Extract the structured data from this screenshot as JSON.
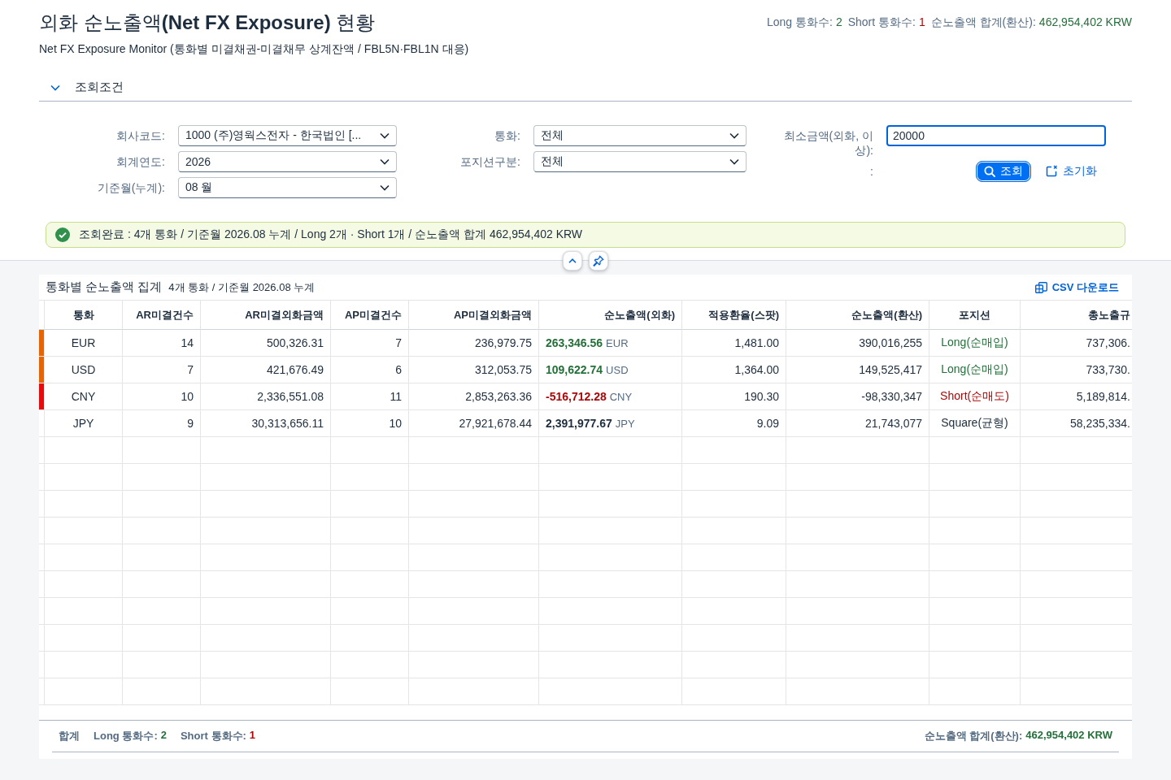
{
  "header": {
    "title": "외화 순노출액**(Net FX Exposure)** 현황",
    "subtitle": "Net FX Exposure Monitor (통화별 미결채권-미결채무 상계잔액 / FBL5N·FBL1N 대응)",
    "summary": [
      {
        "label": "Long 통화수:",
        "value": "2",
        "kind": "long"
      },
      {
        "label": "Short 통화수:",
        "value": "1",
        "kind": "short"
      },
      {
        "label": "순노출액 합계(환산):",
        "value": "462,954,402 KRW",
        "kind": "long"
      }
    ]
  },
  "filter_section": {
    "title": "조회조건",
    "expanded": true,
    "columns": [
      [
        {
          "label": "회사코드:",
          "kind": "dropdown",
          "value": "1000 (주)영웍스전자 - 한국법인 [..."
        },
        {
          "label": "회계연도:",
          "kind": "dropdown",
          "value": "2026"
        },
        {
          "label": "기준월(누계):",
          "kind": "dropdown",
          "value": "08 월"
        }
      ],
      [
        {
          "label": "통화:",
          "kind": "dropdown",
          "value": "전체"
        },
        {
          "label": "포지션구분:",
          "kind": "dropdown",
          "value": "전체"
        }
      ],
      [
        {
          "label": "최소금액(외화, 이상):",
          "kind": "input",
          "value": "20000",
          "focused": true
        },
        {
          "label": ":",
          "kind": "actions",
          "buttons": [
            {
              "label": "조회",
              "kind": "primary"
            },
            {
              "label": "초기화",
              "kind": "reset"
            }
          ]
        }
      ]
    ]
  },
  "message": {
    "kind": "success",
    "text": "조회완료 : 4개 통화 / 기준월 2026.08 누계 / Long 2개 · Short 1개 / 순노출액 합계 462,954,402 KRW"
  },
  "table": {
    "title": "통화별 순노출액 집계",
    "subtitle": "4개 통화 / 기준월 2026.08 누계",
    "action": "CSV 다운로드",
    "columns": [
      "통화",
      "AR미결건수",
      "AR미결외화금액",
      "AP미결건수",
      "AP미결외화금액",
      "순노출액(외화)",
      "적용환율(스팟)",
      "순노출액(환산)",
      "포지션",
      "총노출규"
    ],
    "rows": [
      {
        "currency": "EUR",
        "ar_count": "14",
        "ar_amount": "500,326.31",
        "ap_count": "7",
        "ap_amount": "236,979.75",
        "net_fx": {
          "amount": "263,346.56",
          "currency": "EUR"
        },
        "rate": "1,481.00",
        "net_krw": "390,016,255",
        "position": "Long(순매입)",
        "kind": "long",
        "column_10": "737,306.",
        "color": "#e76500"
      },
      {
        "currency": "USD",
        "ar_count": "7",
        "ar_amount": "421,676.49",
        "ap_count": "6",
        "ap_amount": "312,053.75",
        "net_fx": {
          "amount": "109,622.74",
          "currency": "USD"
        },
        "rate": "1,364.00",
        "net_krw": "149,525,417",
        "position": "Long(순매입)",
        "kind": "long",
        "column_10": "733,730.",
        "color": "#e76500"
      },
      {
        "currency": "CNY",
        "ar_count": "10",
        "ar_amount": "2,336,551.08",
        "ap_count": "11",
        "ap_amount": "2,853,263.36",
        "net_fx": {
          "amount": "-516,712.28",
          "currency": "CNY"
        },
        "rate": "190.30",
        "net_krw": "-98,330,347",
        "position": "Short(순매도)",
        "kind": "short",
        "column_10": "5,189,814.",
        "color": "#e90b0b"
      },
      {
        "currency": "JPY",
        "ar_count": "9",
        "ar_amount": "30,313,656.11",
        "ap_count": "10",
        "ap_amount": "27,921,678.44",
        "net_fx": {
          "amount": "2,391,977.67",
          "currency": "JPY"
        },
        "rate": "9.09",
        "net_krw": "21,743,077",
        "position": "Square(균형)",
        "kind": "square",
        "column_10": "58,235,334."
      }
    ],
    "footer": {
      "label": "합계",
      "counts": [
        {
          "label": "Long 통화수:",
          "value": "2",
          "kind": "long"
        },
        {
          "label": "Short 통화수:",
          "value": "1",
          "kind": "short"
        }
      ],
      "total": {
        "label": "순노출액 합계(환산):",
        "value": "462,954,402 KRW",
        "kind": "long"
      }
    }
  }
}
